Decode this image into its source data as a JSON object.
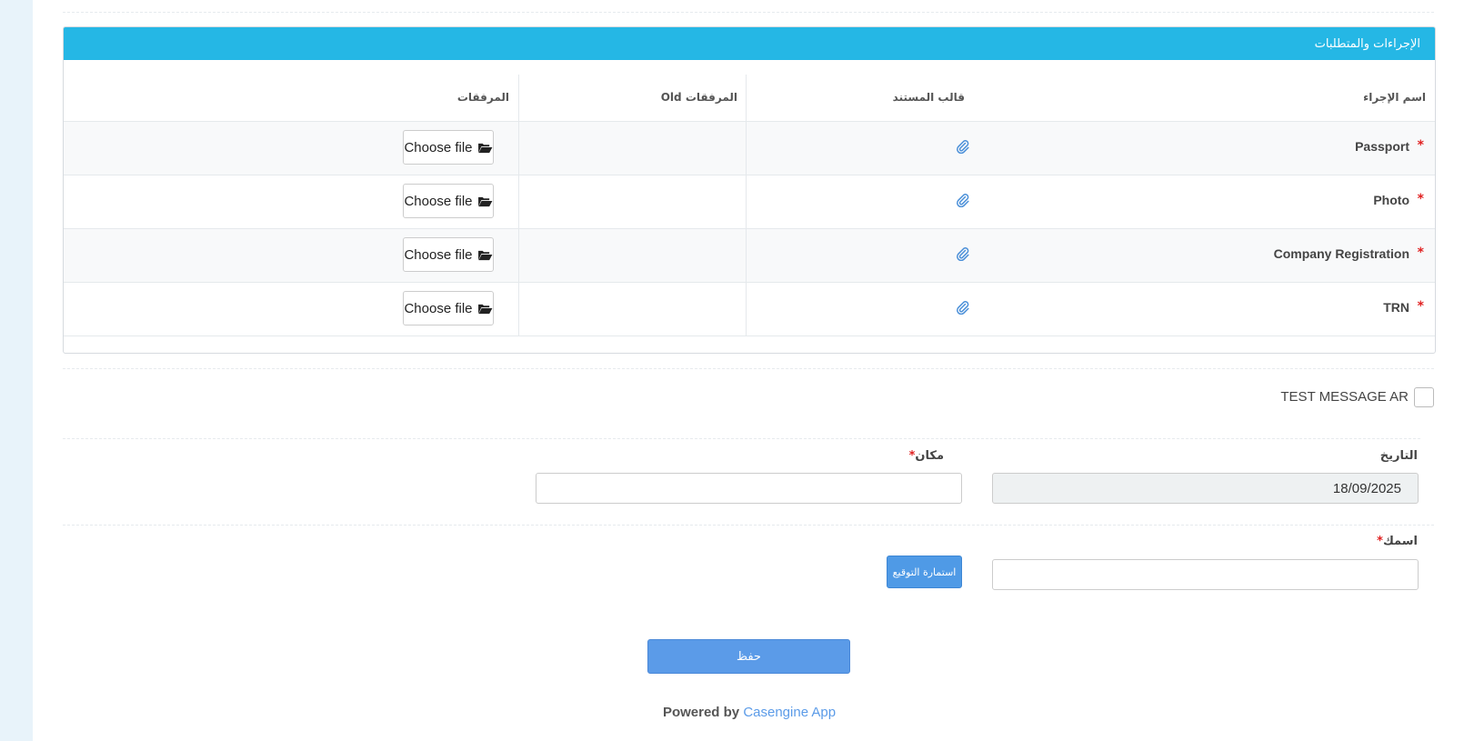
{
  "panel": {
    "title": "الإجراءات والمتطلبات"
  },
  "table": {
    "headers": {
      "procedure_name": "اسم الإجراء",
      "document_template": "قالب المستند",
      "old_attachments": "Old المرفقات",
      "attachments": "المرفقات"
    },
    "rows": [
      {
        "name": "Passport",
        "required": "*",
        "file_button": "Choose file"
      },
      {
        "name": "Photo",
        "required": "*",
        "file_button": "Choose file"
      },
      {
        "name": "Company Registration",
        "required": "*",
        "file_button": "Choose file"
      },
      {
        "name": "TRN",
        "required": "*",
        "file_button": "Choose file"
      }
    ]
  },
  "checkbox": {
    "label": "TEST MESSAGE AR",
    "checked": false
  },
  "form": {
    "date_label": "التاريخ",
    "date_value": "18/09/2025",
    "place_label": "مكان",
    "place_value": "",
    "name_label": "اسمك",
    "name_value": "",
    "required_mark": "*",
    "signature_button": "استمارة التوقيع"
  },
  "save_button": "حفظ",
  "footer": {
    "powered_by": "Powered by",
    "app_name": "Casengine App"
  },
  "colors": {
    "header": "#25b7e5",
    "button": "#5b9be8",
    "required": "#e02020"
  }
}
